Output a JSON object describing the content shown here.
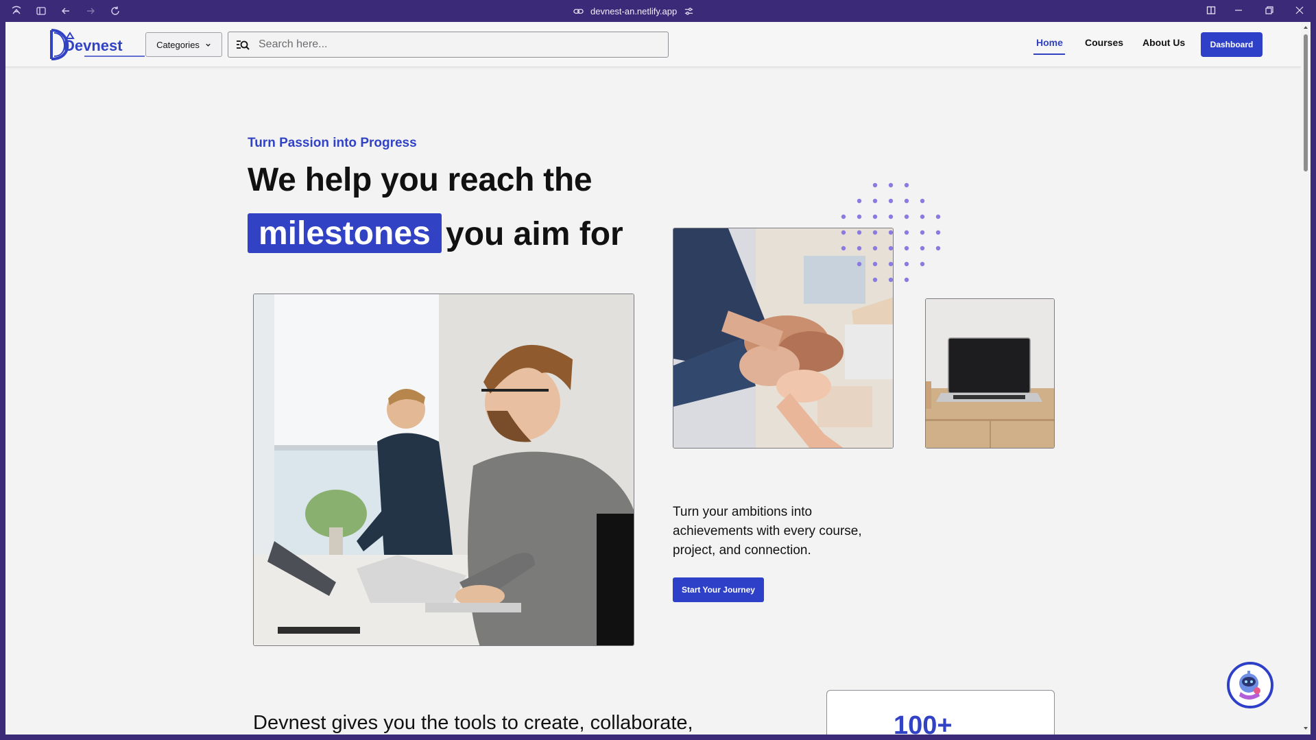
{
  "browser": {
    "url": "devnest-an.netlify.app"
  },
  "navbar": {
    "logo_text": "Devnest",
    "categories_label": "Categories",
    "search_placeholder": "Search here...",
    "links": [
      {
        "label": "Home",
        "active": true
      },
      {
        "label": "Courses",
        "active": false
      },
      {
        "label": "About Us",
        "active": false
      }
    ],
    "dashboard_label": "Dashboard"
  },
  "hero": {
    "tagline": "Turn Passion into Progress",
    "headline_line1": "We help you reach the",
    "headline_highlight": "milestones",
    "headline_line2_rest": "you aim for",
    "description": "Turn your ambitions into achievements with every course, project, and connection.",
    "cta_label": "Start Your Journey"
  },
  "tools_section": {
    "text": "Devnest gives you the tools to create, collaborate,"
  },
  "stats": {
    "value": "100+"
  },
  "colors": {
    "brand": "#3142c4",
    "browser_frame": "#3b2a78",
    "page_bg": "#f3f3f4",
    "dots": "#8b7be0"
  },
  "icons": [
    "app-menu-icon",
    "sidebar-icon",
    "back-icon",
    "forward-icon",
    "reload-icon",
    "link-icon",
    "site-settings-icon",
    "split-view-icon",
    "minimize-icon",
    "restore-icon",
    "close-icon",
    "search-icon",
    "chevron-down-icon",
    "chatbot-icon"
  ]
}
